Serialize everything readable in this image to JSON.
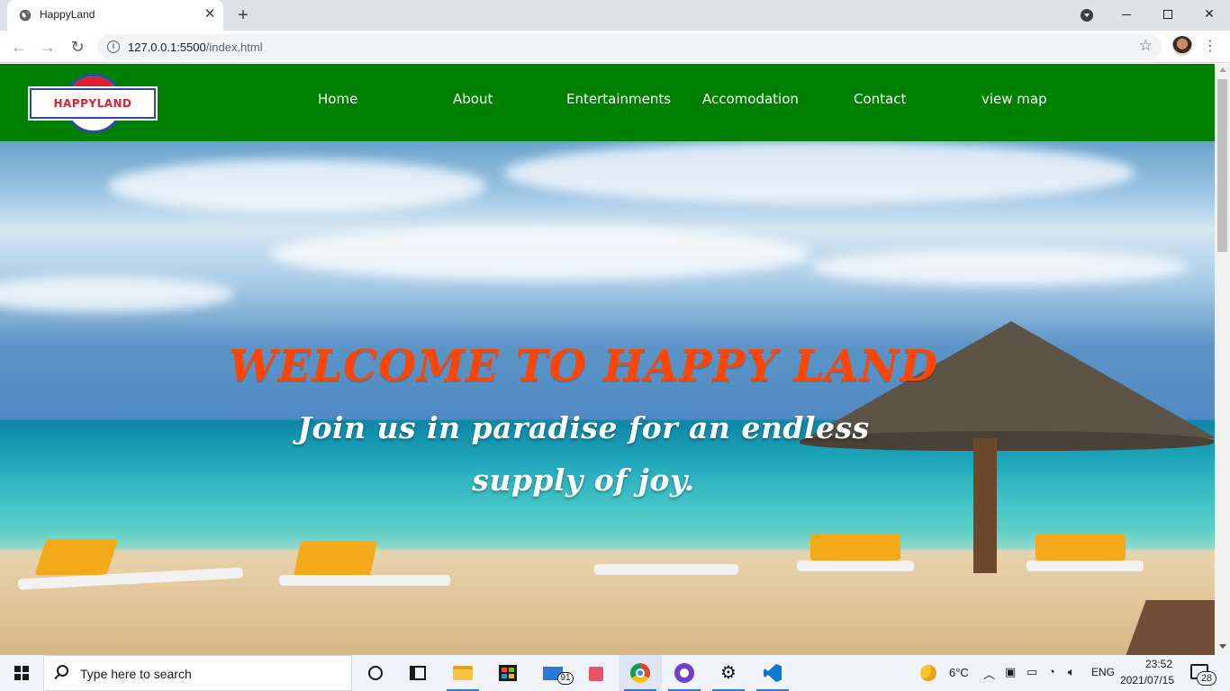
{
  "browser": {
    "tab_title": "HappyLand",
    "url_host": "127.0.0.1:5500",
    "url_path": "/index.html",
    "icons": {
      "back": "arrow-left-icon",
      "forward": "arrow-right-icon",
      "reload": "reload-icon",
      "star": "star-icon",
      "menu": "kebab-icon"
    }
  },
  "site": {
    "logo_text": "HAPPYLAND",
    "nav": [
      "Home",
      "About",
      "Entertainments",
      "Accomodation",
      "Contact",
      "view map"
    ],
    "hero_title": "WELCOME TO HAPPY LAND",
    "hero_subtitle": "Join us in paradise for an endless supply of joy.",
    "colors": {
      "navbar": "#008000",
      "title": "#FF4500",
      "subtitle": "#FFFFFF"
    }
  },
  "taskbar": {
    "search_placeholder": "Type here to search",
    "mail_badge": "91",
    "weather": "6°C",
    "language": "ENG",
    "time": "23:52",
    "date": "2021/07/15",
    "notification_count": "28"
  }
}
